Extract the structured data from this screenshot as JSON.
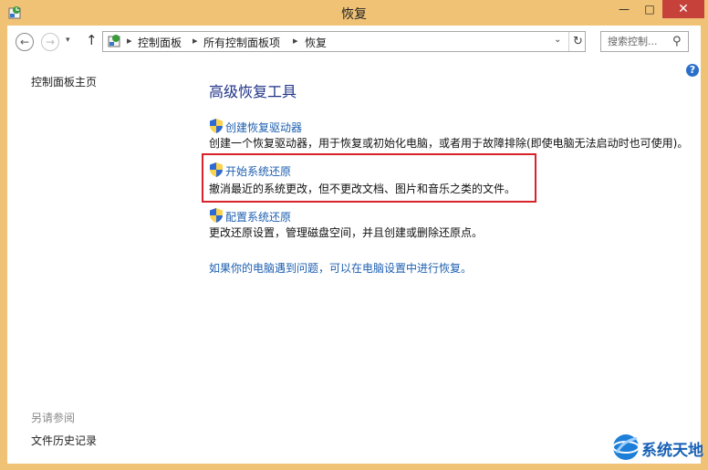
{
  "window": {
    "title": "恢复",
    "controls": {
      "minimize": "—",
      "maximize": "□",
      "close": "✕"
    }
  },
  "nav": {
    "back": "←",
    "forward": "→",
    "recent": "▾",
    "up": "↑",
    "breadcrumb": [
      "控制面板",
      "所有控制面板项",
      "恢复"
    ],
    "separator": "▸",
    "dropdown": "⌄",
    "refresh": "↻",
    "search_placeholder": "搜索控制...",
    "search_value": ""
  },
  "sidebar": {
    "home": "控制面板主页",
    "see_also": "另请参阅",
    "file_history": "文件历史记录"
  },
  "help_icon": "?",
  "main": {
    "heading": "高级恢复工具",
    "items": [
      {
        "title": "创建恢复驱动器",
        "desc": "创建一个恢复驱动器，用于恢复或初始化电脑，或者用于故障排除(即使电脑无法启动时也可使用)。"
      },
      {
        "title": "开始系统还原",
        "desc": "撤消最近的系统更改，但不更改文档、图片和音乐之类的文件。"
      },
      {
        "title": "配置系统还原",
        "desc": "更改还原设置，管理磁盘空间，并且创建或删除还原点。"
      }
    ],
    "bottom_link": "如果你的电脑遇到问题，可以在电脑设置中进行恢复。"
  },
  "watermark": {
    "text": "系统天地"
  },
  "colors": {
    "titlebar": "#f0c276",
    "close_button": "#c7413b",
    "heading": "#1e3287",
    "link": "#1e5fb0",
    "highlight_box": "#d8232a",
    "brand": "#1760b5"
  }
}
